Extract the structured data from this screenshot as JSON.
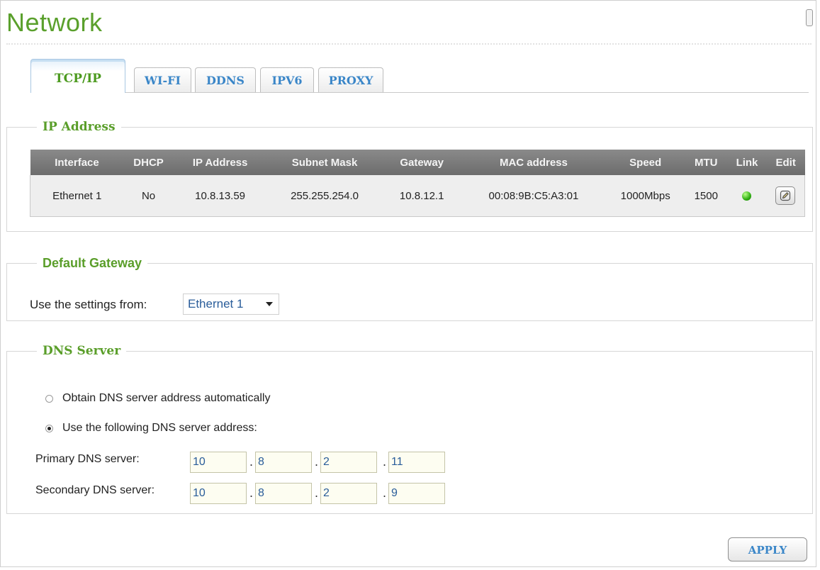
{
  "page": {
    "title": "Network"
  },
  "tabs": [
    {
      "label": "TCP/IP",
      "active": true
    },
    {
      "label": "WI-FI"
    },
    {
      "label": "DDNS"
    },
    {
      "label": "IPV6"
    },
    {
      "label": "PROXY"
    }
  ],
  "ip_address": {
    "legend": "IP Address",
    "columns": [
      "Interface",
      "DHCP",
      "IP Address",
      "Subnet Mask",
      "Gateway",
      "MAC address",
      "Speed",
      "MTU",
      "Link",
      "Edit"
    ],
    "rows": [
      {
        "interface": "Ethernet 1",
        "dhcp": "No",
        "ip": "10.8.13.59",
        "subnet": "255.255.254.0",
        "gateway": "10.8.12.1",
        "mac": "00:08:9B:C5:A3:01",
        "speed": "1000Mbps",
        "mtu": "1500",
        "link_status_color": "#2fae12",
        "edit_icon": "pencil-icon"
      }
    ]
  },
  "default_gateway": {
    "legend": "Default Gateway",
    "label": "Use the settings from:",
    "selected": "Ethernet 1"
  },
  "dns": {
    "legend": "DNS Server",
    "option_auto": "Obtain DNS server address automatically",
    "option_manual": "Use the following DNS server address:",
    "selected_option": "manual",
    "primary_label": "Primary DNS server:",
    "primary": [
      "10",
      "8",
      "2",
      "11"
    ],
    "secondary_label": "Secondary DNS server:",
    "secondary": [
      "10",
      "8",
      "2",
      "9"
    ]
  },
  "footer": {
    "apply_label": "APPLY"
  },
  "colors": {
    "title_green": "#5aa02c",
    "tab_blue": "#3a86c8",
    "legend_green": "#5a9e2a",
    "header_gray": "#7a7a7a"
  }
}
